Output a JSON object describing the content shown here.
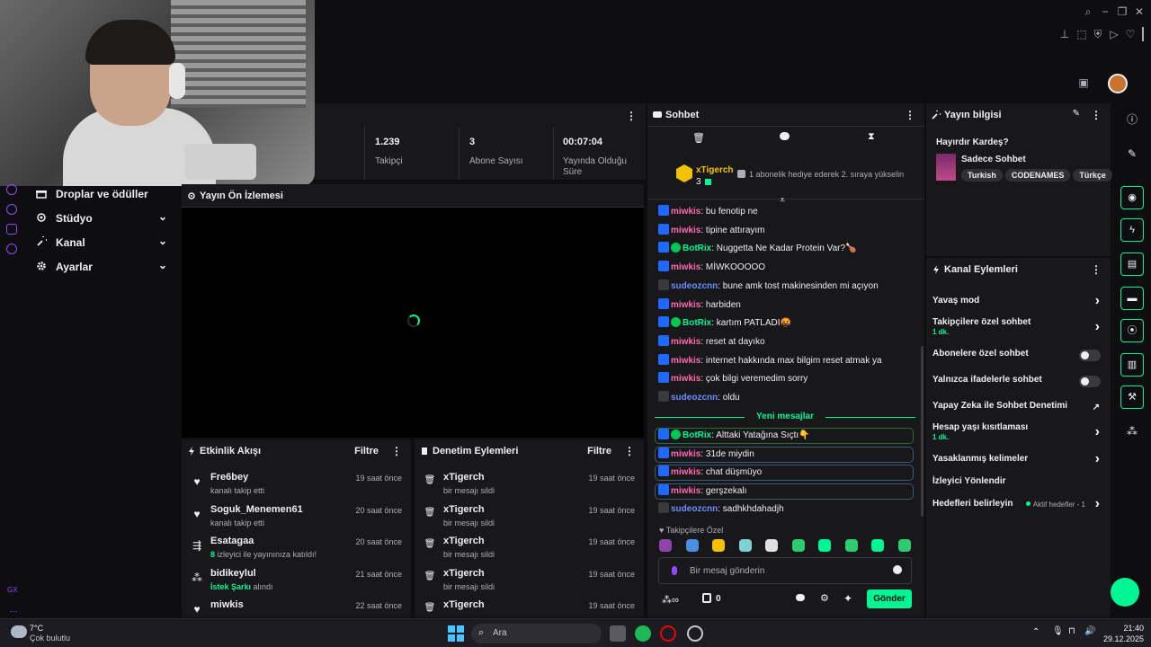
{
  "colors": {
    "accent": "#00f593",
    "purple": "#9147ff",
    "bg": "#0e0e10",
    "panel": "#18181b",
    "pink": "#eb0400",
    "mentionPink": "#ff69b4",
    "blueUser": "#6b8cff"
  },
  "stats": [
    {
      "value": "1.239",
      "label": "Takipçi"
    },
    {
      "value": "3",
      "label": "Abone Sayısı"
    },
    {
      "value": "00:07:04",
      "label": "Yayında Olduğu Süre"
    }
  ],
  "nav": [
    {
      "label": "Droplar ve ödüller"
    },
    {
      "label": "Stüdyo"
    },
    {
      "label": "Kanal"
    },
    {
      "label": "Ayarlar"
    }
  ],
  "preview": {
    "title": "Yayın Ön İzlemesi"
  },
  "activity": {
    "title": "Etkinlik Akışı",
    "filter": "Filtre",
    "rows": [
      {
        "name": "Fre6bey",
        "sub": "kanalı takip etti",
        "time": "19 saat önce"
      },
      {
        "name": "Soguk_Menemen61",
        "sub": "kanalı takip etti",
        "time": "20 saat önce"
      },
      {
        "name": "Esatagaa",
        "sub_hl": "8",
        "sub": " izleyici ile yayınınıza katıldı!",
        "time": "20 saat önce"
      },
      {
        "name": "bidikeylul",
        "sub_hl": "İstek Şarkı",
        "sub": " alındı",
        "time": "21 saat önce"
      },
      {
        "name": "miwkis",
        "sub": "",
        "time": "22 saat önce"
      }
    ]
  },
  "moderation": {
    "title": "Denetim Eylemleri",
    "filter": "Filtre",
    "rows": [
      {
        "name": "xTigerch",
        "sub": "bir mesajı sildi",
        "time": "19 saat önce"
      },
      {
        "name": "xTigerch",
        "sub": "bir mesajı sildi",
        "time": "19 saat önce"
      },
      {
        "name": "xTigerch",
        "sub": "bir mesajı sildi",
        "time": "19 saat önce"
      },
      {
        "name": "xTigerch",
        "sub": "bir mesajı sildi",
        "time": "19 saat önce"
      },
      {
        "name": "xTigerch",
        "sub": "",
        "time": "19 saat önce"
      }
    ]
  },
  "chat": {
    "title": "Sohbet",
    "pinned": {
      "user": "xTigerch",
      "count": "3",
      "text": "1 abonelik hediye ederek 2. sıraya yükselin"
    },
    "messages": [
      {
        "user": "miwkis",
        "text": ": bu fenotip ne",
        "kind": "mod"
      },
      {
        "user": "miwkis",
        "text": ": tipine attırayım",
        "kind": "mod"
      },
      {
        "user": "BotRix",
        "text": ": Nuggetta Ne Kadar Protein Var?🍗",
        "kind": "bot"
      },
      {
        "user": "miwkis",
        "text": ": MİWKOOOOO",
        "kind": "mod"
      },
      {
        "user": "sudeozcnn",
        "text": ": bune amk tost makinesinden mi açıyon",
        "kind": "fan"
      },
      {
        "user": "miwkis",
        "text": ": harbiden",
        "kind": "mod"
      },
      {
        "user": "BotRix",
        "text": ": kartım PATLADI🤬",
        "kind": "bot"
      },
      {
        "user": "miwkis",
        "text": ": reset at dayıko",
        "kind": "mod"
      },
      {
        "user": "miwkis",
        "text": ": internet hakkında max bilgim reset atmak ya",
        "kind": "mod"
      },
      {
        "user": "miwkis",
        "text": ": çok bilgi veremedim sorry",
        "kind": "mod"
      },
      {
        "user": "sudeozcnn",
        "text": ": oldu",
        "kind": "fan"
      }
    ],
    "new_label": "Yeni mesajlar",
    "new_messages": [
      {
        "user": "BotRix",
        "text": ": Alttaki Yatağına Sıçtı👇",
        "kind": "bot"
      },
      {
        "user": "miwkis",
        "text": ": 31de miydin",
        "kind": "mod"
      },
      {
        "user": "miwkis",
        "text": ": chat düşmüyo",
        "kind": "mod"
      },
      {
        "user": "miwkis",
        "text": ": gerşzekalı",
        "kind": "mod"
      },
      {
        "user": "sudeozcnn",
        "text": ": sadhkhdahadjh",
        "kind": "fan"
      }
    ],
    "emote_label": "Takipçilere Özel",
    "input_placeholder": "Bir mesaj gönderin",
    "points": "0",
    "send": "Gönder"
  },
  "info": {
    "title": "Yayın bilgisi",
    "stream_title": "Hayırdır Kardeş?",
    "category": "Sadece Sohbet",
    "tags": [
      "Turkish",
      "CODENAMES",
      "Türkçe"
    ]
  },
  "actions": {
    "title": "Kanal Eylemleri",
    "items": [
      {
        "label": "Yavaş mod",
        "sub": "",
        "ctl": "chev"
      },
      {
        "label": "Takipçilere özel sohbet",
        "sub": "1 dk.",
        "ctl": "chev"
      },
      {
        "label": "Abonelere özel sohbet",
        "sub": "",
        "ctl": "toggle"
      },
      {
        "label": "Yalnızca ifadelerle sohbet",
        "sub": "",
        "ctl": "toggle"
      },
      {
        "label": "Yapay Zeka ile Sohbet Denetimi",
        "sub": "",
        "ctl": "ext"
      },
      {
        "label": "Hesap yaşı kısıtlaması",
        "sub": "1 dk.",
        "ctl": "chev"
      },
      {
        "label": "Yasaklanmış kelimeler",
        "sub": "",
        "ctl": "chev"
      },
      {
        "label": "İzleyici Yönlendir",
        "sub": "",
        "ctl": "none"
      },
      {
        "label": "Hedefleri belirleyin",
        "sub": "",
        "ctl": "chev",
        "extra": "Aktif hedefler - 1"
      }
    ]
  },
  "taskbar": {
    "weather_temp": "7°C",
    "weather_desc": "Çok bulutlu",
    "search": "Ara",
    "time": "21:40",
    "date": "29.12.2025"
  },
  "leftrail": {
    "gx": "GX"
  }
}
